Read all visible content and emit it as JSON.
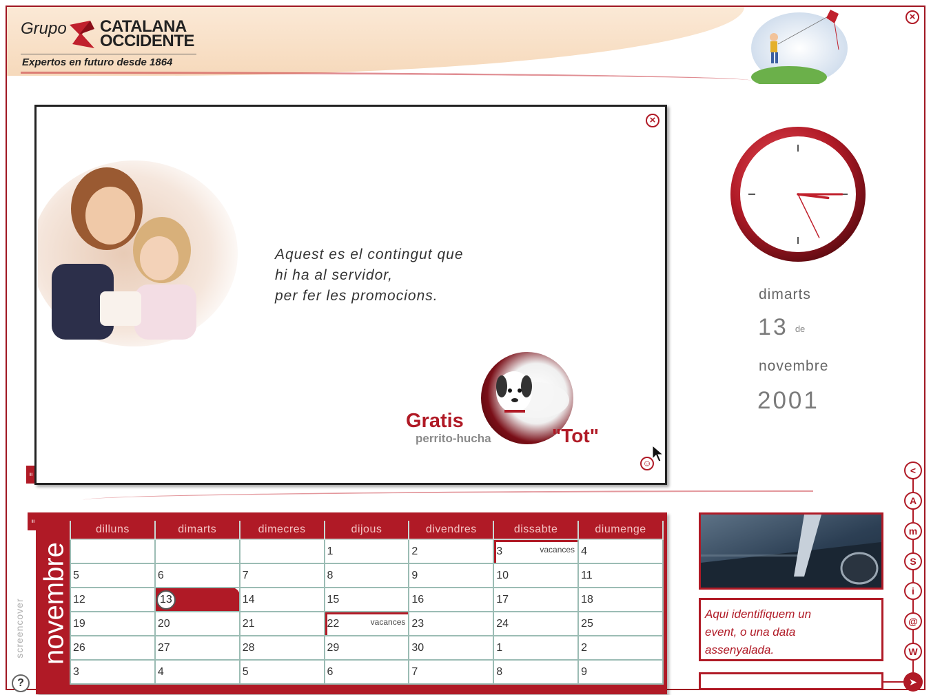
{
  "header": {
    "logo_grupo": "Grupo",
    "logo_name_line1": "CATALANA",
    "logo_name_line2": "OCCIDENTE",
    "tagline": "Expertos en futuro desde 1864",
    "close_icon": "close-icon"
  },
  "promo": {
    "text_lines": [
      "Aquest es el contingut que",
      "hi ha  al servidor,",
      "per fer les promocions."
    ],
    "gratis": "Gratis",
    "perrito": "perrito-hucha",
    "tot": "\"Tot\""
  },
  "clock": {
    "hour": 2,
    "minute": 14,
    "second": 29
  },
  "date": {
    "weekday": "dimarts",
    "day": "13",
    "de": "de",
    "month": "novembre",
    "year": "2001"
  },
  "calendar": {
    "month_label": "novembre",
    "headers": [
      "dilluns",
      "dimarts",
      "dimecres",
      "dijous",
      "divendres",
      "dissabte",
      "diumenge"
    ],
    "rows": [
      [
        "",
        "",
        "",
        "1",
        "2",
        "3",
        "4"
      ],
      [
        "5",
        "6",
        "7",
        "8",
        "9",
        "10",
        "11"
      ],
      [
        "12",
        "13",
        "14",
        "15",
        "16",
        "17",
        "18"
      ],
      [
        "19",
        "20",
        "21",
        "22",
        "23",
        "24",
        "25"
      ],
      [
        "26",
        "27",
        "28",
        "29",
        "30",
        "1",
        "2"
      ],
      [
        "3",
        "4",
        "5",
        "6",
        "7",
        "8",
        "9"
      ]
    ],
    "today": "13",
    "events": [
      {
        "day": "3",
        "label": "vacances"
      },
      {
        "day": "22",
        "label": "vacances"
      }
    ]
  },
  "brand_vertical": "screencover",
  "help_label": "?",
  "event_panel": {
    "text_lines": [
      "Aqui identifiquem un",
      "event, o una data",
      "assenyalada."
    ]
  },
  "nav_buttons": [
    "<",
    "A",
    "m",
    "S",
    "i",
    "@",
    "W"
  ],
  "colors": {
    "accent": "#b01a26",
    "grid": "#9bbcb4",
    "header_band": "#f6d9bb"
  }
}
